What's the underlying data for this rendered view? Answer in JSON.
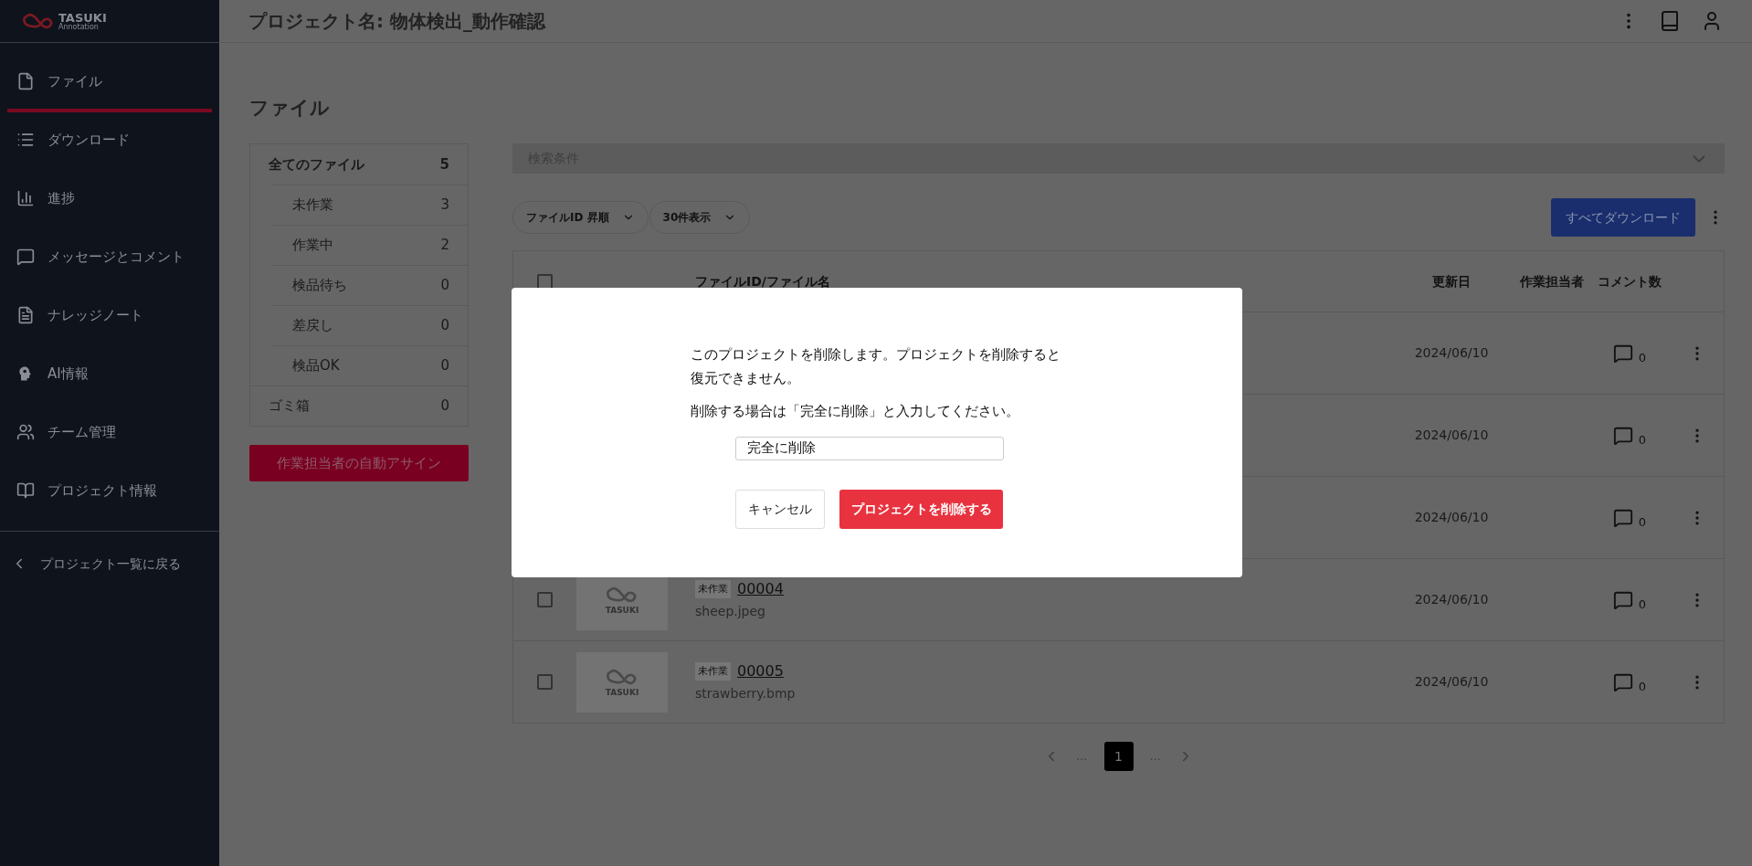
{
  "header": {
    "title": "プロジェクト名: 物体検出_動作確認"
  },
  "sidebar": {
    "logo": {
      "name": "TASUKI",
      "sub": "Annotation"
    },
    "items": [
      {
        "label": "ファイル",
        "selected": true
      },
      {
        "label": "ダウンロード",
        "selected": false
      },
      {
        "label": "進捗",
        "selected": false
      },
      {
        "label": "メッセージとコメント",
        "selected": false
      },
      {
        "label": "ナレッジノート",
        "selected": false
      },
      {
        "label": "AI情報",
        "selected": false
      },
      {
        "label": "チーム管理",
        "selected": false
      },
      {
        "label": "プロジェクト情報",
        "selected": false
      }
    ],
    "back": "プロジェクト一覧に戻る"
  },
  "page_title": "ファイル",
  "filters": [
    {
      "label": "全てのファイル",
      "count": "5",
      "kind": "all",
      "selected": true
    },
    {
      "label": "未作業",
      "count": "3",
      "kind": "status",
      "selected": false
    },
    {
      "label": "作業中",
      "count": "2",
      "kind": "status",
      "selected": false
    },
    {
      "label": "検品待ち",
      "count": "0",
      "kind": "status",
      "selected": false
    },
    {
      "label": "差戻し",
      "count": "0",
      "kind": "status",
      "selected": false
    },
    {
      "label": "検品OK",
      "count": "0",
      "kind": "status",
      "selected": false
    },
    {
      "label": "ゴミ箱",
      "count": "0",
      "kind": "trash",
      "selected": false
    }
  ],
  "auto_assign_button": "作業担当者の自動アサイン",
  "search": {
    "label": "検索条件"
  },
  "sort_controls": [
    "ファイルID 昇順",
    "30件表示"
  ],
  "download_all": "すべてダウンロード",
  "table": {
    "select_all_checked": false,
    "columns": [
      "ファイルID/ファイル名",
      "更新日",
      "作業担当者",
      "コメント数"
    ],
    "rows": [
      {
        "updated": "2024/06/10",
        "comments": "0"
      },
      {
        "updated": "2024/06/10",
        "comments": "0"
      },
      {
        "updated": "2024/06/10",
        "comments": "0"
      },
      {
        "checked": false,
        "status": "未作業",
        "file_id": "00004",
        "file_name": "sheep.jpeg",
        "thumbnail": "TASUKI",
        "updated": "2024/06/10",
        "comments": "0"
      },
      {
        "checked": false,
        "status": "未作業",
        "file_id": "00005",
        "file_name": "strawberry.bmp",
        "thumbnail": "TASUKI",
        "updated": "2024/06/10",
        "comments": "0"
      }
    ]
  },
  "pagination": {
    "ellipsis_before": "...",
    "pages": [
      {
        "label": "1",
        "selected": true
      }
    ],
    "ellipsis_after": "..."
  },
  "modal": {
    "message": "このプロジェクトを削除します。プロジェクトを削除すると復元できません。",
    "instruction": "削除する場合は「完全に削除」と入力してください。",
    "input_value": "完全に削除",
    "cancel": "キャンセル",
    "confirm": "プロジェクトを削除する"
  }
}
